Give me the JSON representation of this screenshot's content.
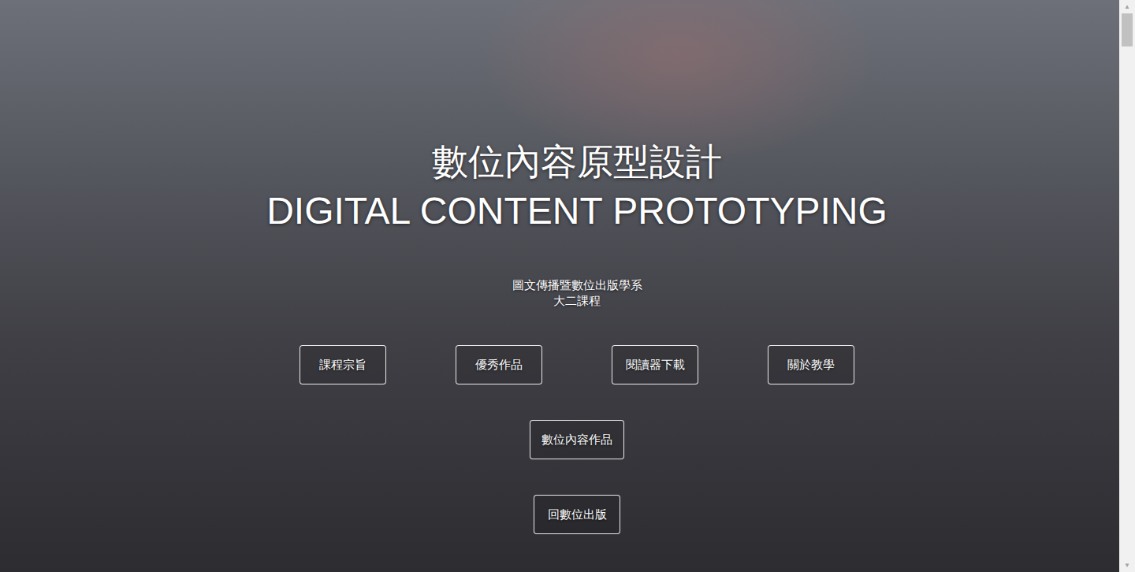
{
  "page": {
    "title": "數位內容原型設計",
    "subtitle": "DIGITAL CONTENT PROTOTYPING",
    "department": "圖文傳播暨數位出版學系",
    "course": "大二課程"
  },
  "nav_rows": [
    [
      {
        "label": "課程宗旨"
      },
      {
        "label": "優秀作品"
      },
      {
        "label": "閱讀器下載"
      },
      {
        "label": "關於教學"
      }
    ],
    [
      {
        "label": "數位內容作品"
      }
    ],
    [
      {
        "label": "回數位出版"
      }
    ]
  ],
  "scrollbar": {
    "up": "▲",
    "down": "▼",
    "level": 0.06
  }
}
